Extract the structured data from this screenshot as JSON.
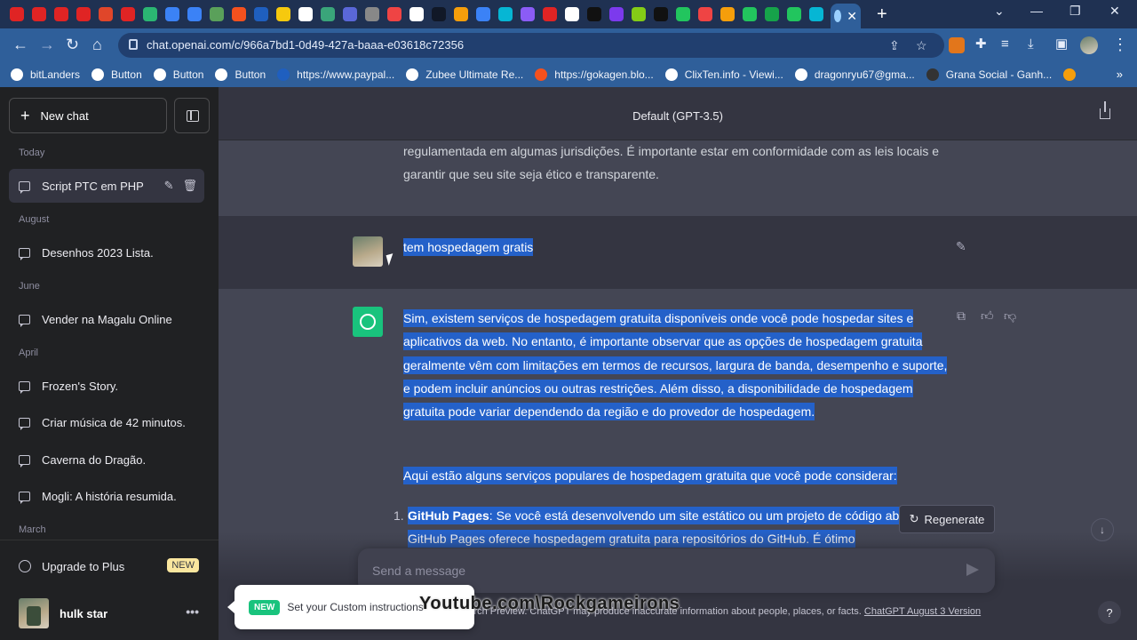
{
  "browser": {
    "url": "chat.openai.com/c/966a7bd1-0d49-427a-baaa-e03618c72356",
    "tab_icon_colors": [
      "#e02424",
      "#e02424",
      "#e02424",
      "#e02424",
      "#e0462a",
      "#e02424",
      "#2bb673",
      "#3b82f6",
      "#3b82f6",
      "#5aa05a",
      "#f4511e",
      "#1f5fbf",
      "#f6c90e",
      "#ffffff",
      "#3aa57a",
      "#5a67d8",
      "#888888",
      "#ef4444",
      "#ffffff",
      "#111827",
      "#f59e0b",
      "#3b82f6",
      "#06b6d4",
      "#8b5cf6",
      "#e02424",
      "#ffffff",
      "#111111",
      "#7c3aed",
      "#84cc16",
      "#111111",
      "#22c55e",
      "#ef4444",
      "#f59e0b",
      "#22c55e",
      "#16a34a",
      "#22c55e",
      "#06b6d4"
    ],
    "bookmarks": [
      {
        "label": "bitLanders",
        "color": "#ffffff"
      },
      {
        "label": "Button",
        "color": "#ffffff"
      },
      {
        "label": "Button",
        "color": "#ffffff"
      },
      {
        "label": "Button",
        "color": "#ffffff"
      },
      {
        "label": "https://www.paypal...",
        "color": "#1f5fbf"
      },
      {
        "label": "Zubee Ultimate Re...",
        "color": "#ffffff"
      },
      {
        "label": "https://gokagen.blo...",
        "color": "#f4511e"
      },
      {
        "label": "ClixTen.info - Viewi...",
        "color": "#ffffff"
      },
      {
        "label": "dragonryu67@gma...",
        "color": "#ffffff"
      },
      {
        "label": "Grana Social - Ganh...",
        "color": "#333333"
      },
      {
        "label": "",
        "color": "#f59e0b"
      }
    ]
  },
  "sidebar": {
    "new_chat": "New chat",
    "groups": {
      "today": "Today",
      "august": "August",
      "june": "June",
      "april": "April",
      "march": "March"
    },
    "conversations": [
      "Script PTC em PHP",
      "Desenhos 2023 Lista.",
      "Vender na Magalu Online",
      "Frozen's Story.",
      "Criar música de 42 minutos.",
      "Caverna do Dragão.",
      "Mogli: A história resumida."
    ],
    "upgrade": "Upgrade to Plus",
    "new_badge": "NEW",
    "user_name": "hulk star"
  },
  "main": {
    "model": "Default (GPT-3.5)",
    "prev_text": "regulamentada em algumas jurisdições. É importante estar em conformidade com as leis locais e garantir que seu site seja ético e transparente.",
    "user_message": "tem hospedagem gratis",
    "assistant_p1": "Sim, existem serviços de hospedagem gratuita disponíveis onde você pode hospedar sites e aplicativos da web. No entanto, é importante observar que as opções de hospedagem gratuita geralmente vêm com limitações em termos de recursos, largura de banda, desempenho e suporte, e podem incluir anúncios ou outras restrições. Além disso, a disponibilidade de hospedagem gratuita pode variar dependendo da região e do provedor de hospedagem.",
    "assistant_p2": "Aqui estão alguns serviços populares de hospedagem gratuita que você pode considerar:",
    "list_item1_title": "GitHub Pages",
    "list_item1_text": ": Se você está desenvolvendo um site estático ou um projeto de código aberto, o GitHub Pages oferece hospedagem gratuita para repositórios do GitHub. É ótimo",
    "regenerate": "Regenerate",
    "placeholder": "Send a message",
    "disclaimer": "Free Research Preview. ChatGPT may produce inaccurate information about people, places, or facts.",
    "version_link": "ChatGPT August 3 Version",
    "help": "?"
  },
  "toast": {
    "badge": "NEW",
    "text": "Set your Custom instructions"
  },
  "watermark": "Youtube.com\\Rockgameirons"
}
